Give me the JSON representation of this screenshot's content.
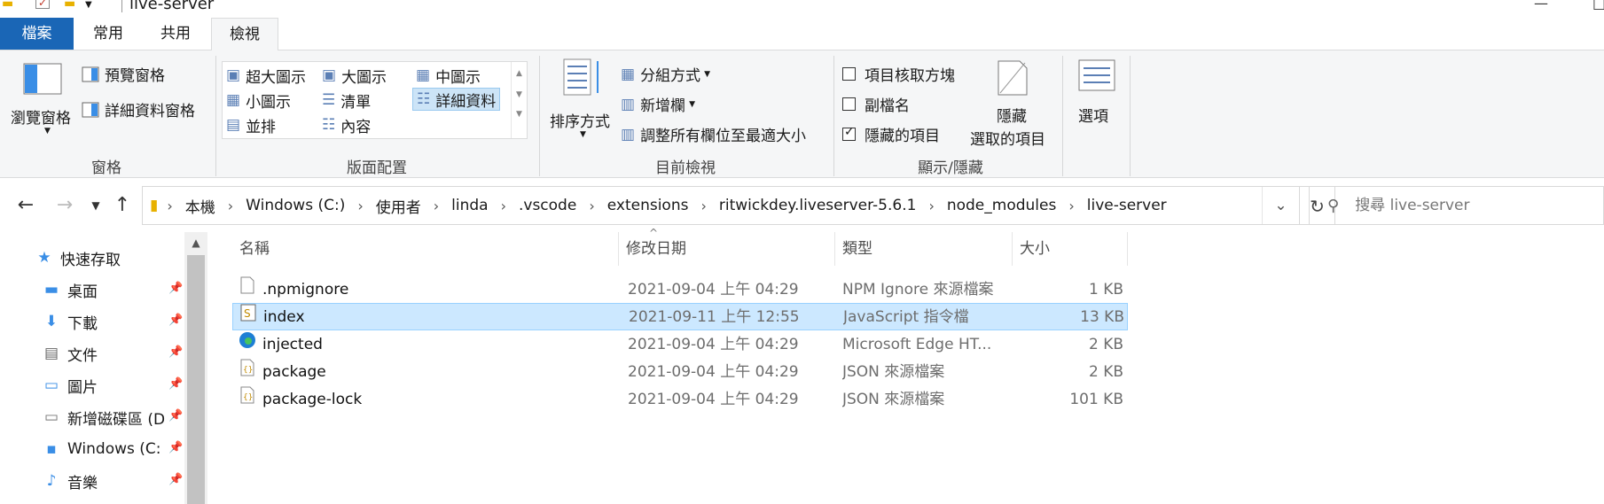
{
  "window": {
    "title": "live-server",
    "minimize_glyph": "—",
    "restore_glyph": "□"
  },
  "tabs": {
    "file": "檔案",
    "home": "常用",
    "share": "共用",
    "view": "檢視"
  },
  "ribbon": {
    "panes": {
      "label": "窗格",
      "nav_pane": "瀏覽窗格",
      "preview_pane": "預覽窗格",
      "details_pane": "詳細資料窗格"
    },
    "layout": {
      "label": "版面配置",
      "items": [
        "超大圖示",
        "大圖示",
        "中圖示",
        "小圖示",
        "清單",
        "詳細資料",
        "並排",
        "內容"
      ],
      "selected": "詳細資料"
    },
    "current_view": {
      "label": "目前檢視",
      "sort": "排序方式",
      "group_by": "分組方式",
      "add_columns": "新增欄",
      "fit_columns": "調整所有欄位至最適大小"
    },
    "show_hide": {
      "label": "顯示/隱藏",
      "item_checkboxes": "項目核取方塊",
      "file_extensions": "副檔名",
      "hidden_items": "隱藏的項目",
      "hide_selected_line1": "隱藏",
      "hide_selected_line2": "選取的項目"
    },
    "options": "選項"
  },
  "address": {
    "crumbs": [
      "本機",
      "Windows (C:)",
      "使用者",
      "linda",
      ".vscode",
      "extensions",
      "ritwickdey.liveserver-5.6.1",
      "node_modules",
      "live-server"
    ],
    "search_placeholder": "搜尋 live-server"
  },
  "navpane": {
    "items": [
      {
        "label": "快速存取",
        "icon": "star-icon"
      },
      {
        "label": "桌面",
        "icon": "desktop-icon"
      },
      {
        "label": "下載",
        "icon": "download-icon"
      },
      {
        "label": "文件",
        "icon": "document-icon"
      },
      {
        "label": "圖片",
        "icon": "pictures-icon"
      },
      {
        "label": "新增磁碟區 (D",
        "icon": "drive-icon"
      },
      {
        "label": "Windows (C:",
        "icon": "windows-drive-icon"
      },
      {
        "label": "音樂",
        "icon": "music-icon"
      }
    ]
  },
  "columns": {
    "name": "名稱",
    "date": "修改日期",
    "type": "類型",
    "size": "大小"
  },
  "files": [
    {
      "name": ".npmignore",
      "date": "2021-09-04 上午 04:29",
      "type": "NPM Ignore 來源檔案",
      "size": "1 KB",
      "icon": "generic-file-icon"
    },
    {
      "name": "index",
      "date": "2021-09-11 上午 12:55",
      "type": "JavaScript 指令檔",
      "size": "13 KB",
      "icon": "script-file-icon"
    },
    {
      "name": "injected",
      "date": "2021-09-04 上午 04:29",
      "type": "Microsoft Edge HT...",
      "size": "2 KB",
      "icon": "edge-icon"
    },
    {
      "name": "package",
      "date": "2021-09-04 上午 04:29",
      "type": "JSON 來源檔案",
      "size": "2 KB",
      "icon": "json-file-icon"
    },
    {
      "name": "package-lock",
      "date": "2021-09-04 上午 04:29",
      "type": "JSON 來源檔案",
      "size": "101 KB",
      "icon": "json-file-icon"
    }
  ],
  "colors": {
    "accent": "#1a66b6",
    "selection": "#cce8ff"
  }
}
